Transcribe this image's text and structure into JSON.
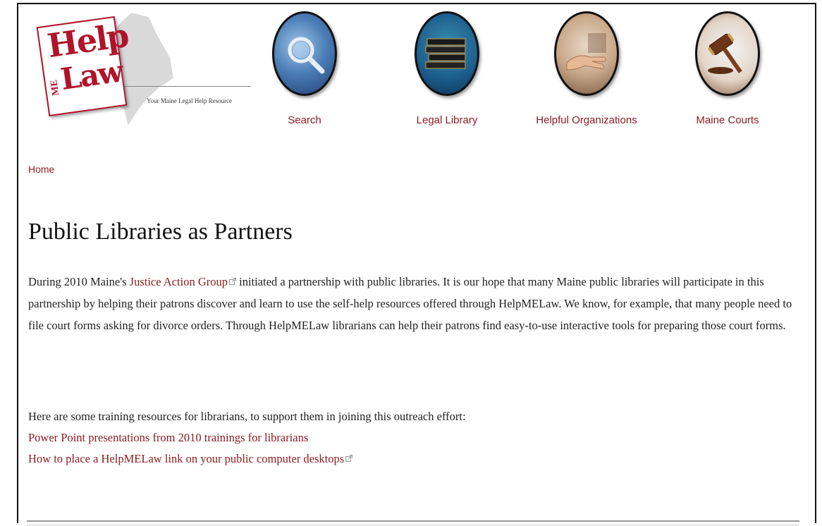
{
  "logo": {
    "line1": "Help",
    "line2": "ME",
    "line3": "Law",
    "tagline": "Your Maine Legal Help Resource"
  },
  "nav": [
    {
      "label": "Search",
      "icon": "magnifier-icon"
    },
    {
      "label": "Legal Library",
      "icon": "books-icon"
    },
    {
      "label": "Helpful Organizations",
      "icon": "helping-hand-icon"
    },
    {
      "label": "Maine Courts",
      "icon": "gavel-icon"
    }
  ],
  "breadcrumb": {
    "home": "Home"
  },
  "page": {
    "title": "Public Libraries as Partners",
    "intro": {
      "before_link": "During 2010 Maine's ",
      "link": "Justice Action Group",
      "after_link": " initiated a partnership with public libraries. It is our hope that many Maine public libraries will participate in this partnership by helping their patrons discover and learn to use the self-help resources offered through HelpMELaw. We know, for example, that many people need to file court forms asking for divorce orders. Through HelpMELaw librarians can help their patrons find easy-to-use interactive tools for preparing those court forms."
    },
    "resources_intro": "Here are some training resources for librarians, to support them in joining this outreach effort:",
    "resources": [
      {
        "label": "Power Point presentations from 2010 trainings for librarians"
      },
      {
        "label": "How to place a HelpMELaw link on your public computer desktops"
      }
    ]
  },
  "colors": {
    "accent": "#8c1d23",
    "logo_red": "#b0142a"
  }
}
